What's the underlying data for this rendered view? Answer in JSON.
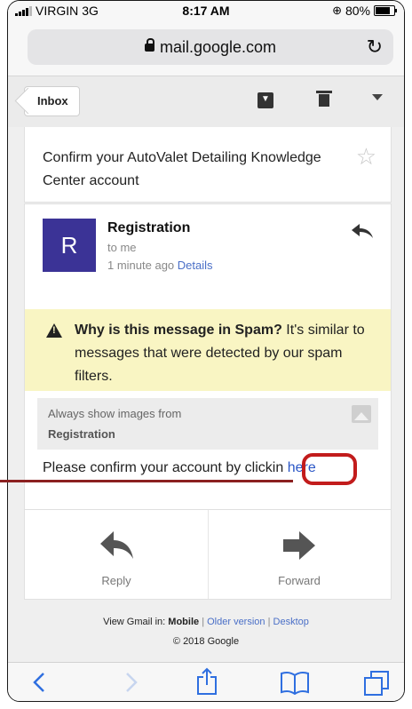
{
  "status": {
    "carrier": "VIRGIN",
    "network": "3G",
    "time": "8:17 AM",
    "battery": "80%",
    "battery_level": 0.8
  },
  "browser": {
    "url": "mail.google.com"
  },
  "toolbar": {
    "back_label": "Inbox"
  },
  "email": {
    "subject": "Confirm your AutoValet Detailing Knowledge Center account",
    "avatar_letter": "R",
    "sender": "Registration",
    "to": "to me",
    "time": "1 minute ago",
    "details_link": "Details",
    "spam_heading": "Why is this message in Spam?",
    "spam_text": "It's similar to messages that were detected by our spam filters.",
    "images_label": "Always show images from",
    "images_sender": "Registration",
    "body_text": "Please confirm your account by clickin",
    "body_link": "here"
  },
  "actions": {
    "reply": "Reply",
    "forward": "Forward"
  },
  "footer": {
    "view_in": "View Gmail in:",
    "mobile": "Mobile",
    "older": "Older version",
    "desktop": "Desktop",
    "copyright": "© 2018 Google"
  },
  "colors": {
    "avatar": "#3b3396",
    "spam_bg": "#f9f5c3",
    "highlight": "#c21c1c",
    "link": "#2a56c6"
  }
}
